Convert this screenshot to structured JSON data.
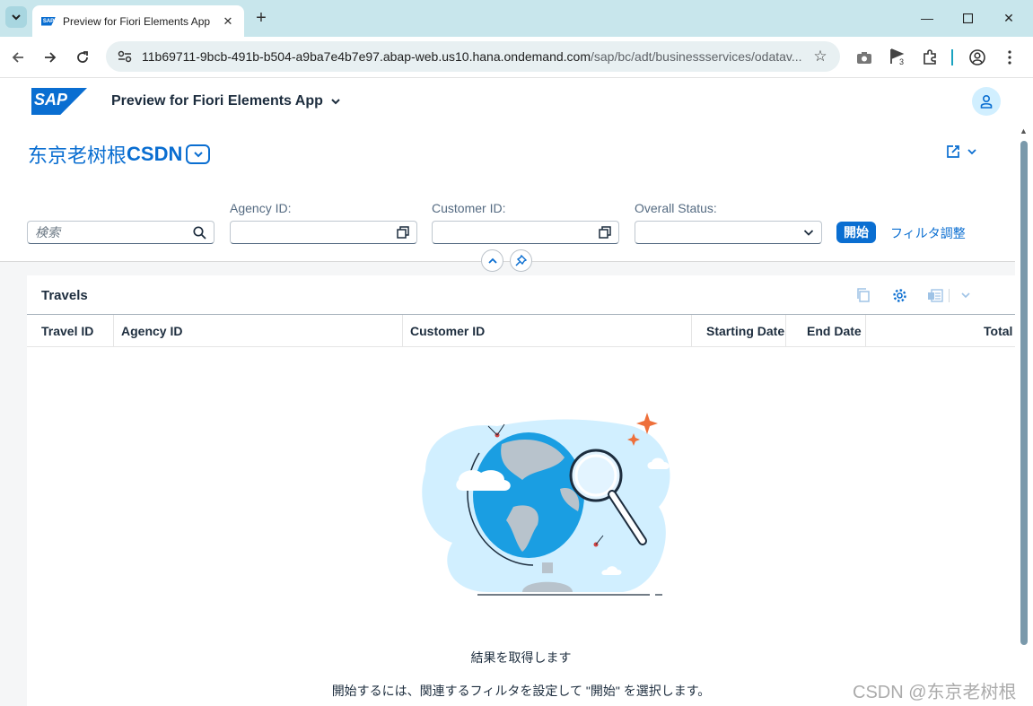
{
  "browser": {
    "tab_title": "Preview for Fiori Elements App",
    "url_host": "11b69711-9bcb-491b-b504-a9ba7e4b7e97.abap-web.us10.hana.ondemand.com",
    "url_path": "/sap/bc/adt/businessservices/odatav...",
    "extension_badge": "3"
  },
  "shell": {
    "logo_text": "SAP",
    "app_title": "Preview for Fiori Elements App"
  },
  "header": {
    "variant_title_cjk": "东京老树根",
    "variant_title_bold": "CSDN"
  },
  "filters": {
    "search_placeholder": "検索",
    "agency_label": "Agency ID:",
    "customer_label": "Customer ID:",
    "status_label": "Overall Status:",
    "agency_value": "",
    "customer_value": "",
    "status_value": "",
    "go_label": "開始",
    "adapt_label": "フィルタ調整"
  },
  "table": {
    "title": "Travels",
    "columns": [
      "Travel ID",
      "Agency ID",
      "Customer ID",
      "Starting Date",
      "End Date",
      "Total F"
    ],
    "nodata_title": "結果を取得します",
    "nodata_desc": "開始するには、関連するフィルタを設定して \"開始\" を選択します。"
  },
  "colors": {
    "accent": "#0a6ed1",
    "tabstrip": "#c8e6ec",
    "content_bg": "#f5f6f7"
  },
  "watermark": "CSDN @东京老树根"
}
